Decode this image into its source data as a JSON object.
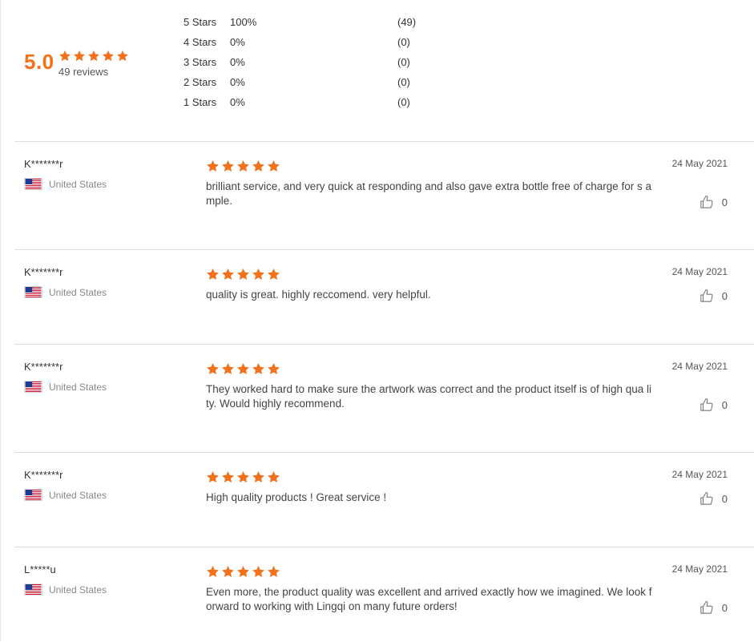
{
  "summary": {
    "average": "5.0",
    "review_count": "49 reviews",
    "rating_stars": 5,
    "breakdown": [
      {
        "label": "5 Stars",
        "percent": "100%",
        "count": "(49)"
      },
      {
        "label": "4 Stars",
        "percent": "0%",
        "count": "(0)"
      },
      {
        "label": "3 Stars",
        "percent": "0%",
        "count": "(0)"
      },
      {
        "label": "2 Stars",
        "percent": "0%",
        "count": "(0)"
      },
      {
        "label": "1 Stars",
        "percent": "0%",
        "count": "(0)"
      }
    ]
  },
  "colors": {
    "accent": "#f2711c",
    "divider": "#dcdcdc"
  },
  "reviews": [
    {
      "name": "K*******r",
      "country": "United States",
      "flag": "us-flag-icon",
      "rating": 5,
      "text": "brilliant service, and very quick at responding and also gave extra bottle free of charge for s ample.",
      "date": "24 May 2021",
      "likes": "0"
    },
    {
      "name": "K*******r",
      "country": "United States",
      "flag": "us-flag-icon",
      "rating": 5,
      "text": "quality is great. highly reccomend. very helpful.",
      "date": "24 May 2021",
      "likes": "0"
    },
    {
      "name": "K*******r",
      "country": "United States",
      "flag": "us-flag-icon",
      "rating": 5,
      "text": "They worked hard to make sure the artwork was correct and the product itself is of high qua lity. Would highly recommend.",
      "date": "24 May 2021",
      "likes": "0"
    },
    {
      "name": "K*******r",
      "country": "United States",
      "flag": "us-flag-icon",
      "rating": 5,
      "text": "High quality products ! Great service !",
      "date": "24 May 2021",
      "likes": "0"
    },
    {
      "name": "L*****u",
      "country": "United States",
      "flag": "us-flag-icon",
      "rating": 5,
      "text": "Even more, the product quality was excellent and arrived exactly how we imagined. We look forward to working with Lingqi on many future orders!",
      "date": "24 May 2021",
      "likes": "0"
    }
  ]
}
